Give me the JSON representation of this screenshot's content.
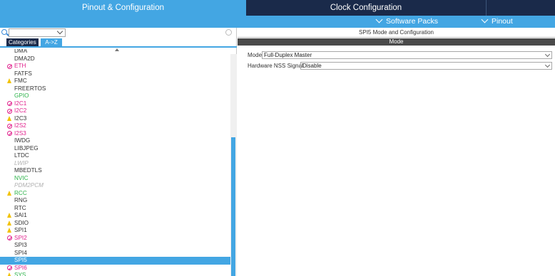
{
  "top_tabs": {
    "pinout": "Pinout & Configuration",
    "clock": "Clock Configuration"
  },
  "sub_header": {
    "software_packs": "Software Packs",
    "pinout": "Pinout"
  },
  "left": {
    "search": {
      "value": "",
      "placeholder": ""
    },
    "view_tabs": {
      "categories": "Categories",
      "az": "A->Z"
    },
    "items": [
      {
        "label": "DMA",
        "status": "none",
        "color": "#333333"
      },
      {
        "label": "DMA2D",
        "status": "none",
        "color": "#333333"
      },
      {
        "label": "ETH",
        "status": "ban",
        "color": "#e0208c"
      },
      {
        "label": "FATFS",
        "status": "none",
        "color": "#333333"
      },
      {
        "label": "FMC",
        "status": "warn",
        "color": "#333333"
      },
      {
        "label": "FREERTOS",
        "status": "none",
        "color": "#333333"
      },
      {
        "label": "GPIO",
        "status": "none",
        "color": "#2db34a"
      },
      {
        "label": "I2C1",
        "status": "ban",
        "color": "#e0208c"
      },
      {
        "label": "I2C2",
        "status": "ban",
        "color": "#e0208c"
      },
      {
        "label": "I2C3",
        "status": "warn",
        "color": "#333333"
      },
      {
        "label": "I2S2",
        "status": "ban",
        "color": "#e0208c"
      },
      {
        "label": "I2S3",
        "status": "ban",
        "color": "#e0208c"
      },
      {
        "label": "IWDG",
        "status": "none",
        "color": "#333333"
      },
      {
        "label": "LIBJPEG",
        "status": "none",
        "color": "#333333"
      },
      {
        "label": "LTDC",
        "status": "none",
        "color": "#333333"
      },
      {
        "label": "LWIP",
        "status": "none",
        "color": "#b0b0b0"
      },
      {
        "label": "MBEDTLS",
        "status": "none",
        "color": "#333333"
      },
      {
        "label": "NVIC",
        "status": "none",
        "color": "#2db34a"
      },
      {
        "label": "PDM2PCM",
        "status": "none",
        "color": "#b0b0b0"
      },
      {
        "label": "RCC",
        "status": "warn",
        "color": "#2db34a"
      },
      {
        "label": "RNG",
        "status": "none",
        "color": "#333333"
      },
      {
        "label": "RTC",
        "status": "none",
        "color": "#333333"
      },
      {
        "label": "SAI1",
        "status": "warn",
        "color": "#333333"
      },
      {
        "label": "SDIO",
        "status": "warn",
        "color": "#333333"
      },
      {
        "label": "SPI1",
        "status": "warn",
        "color": "#333333"
      },
      {
        "label": "SPI2",
        "status": "ban",
        "color": "#e0208c"
      },
      {
        "label": "SPI3",
        "status": "none",
        "color": "#333333"
      },
      {
        "label": "SPI4",
        "status": "none",
        "color": "#333333"
      },
      {
        "label": "SPI5",
        "status": "none",
        "color": "#ffffff",
        "selected": true
      },
      {
        "label": "SPI6",
        "status": "ban",
        "color": "#e0208c"
      },
      {
        "label": "SYS",
        "status": "warn",
        "color": "#2db34a"
      }
    ]
  },
  "right": {
    "title": "SPI5 Mode and Configuration",
    "mode_header": "Mode",
    "mode_label": "Mode",
    "mode_value": "Full-Duplex Master",
    "nss_label": "Hardware NSS Signal",
    "nss_value": "Disable"
  }
}
